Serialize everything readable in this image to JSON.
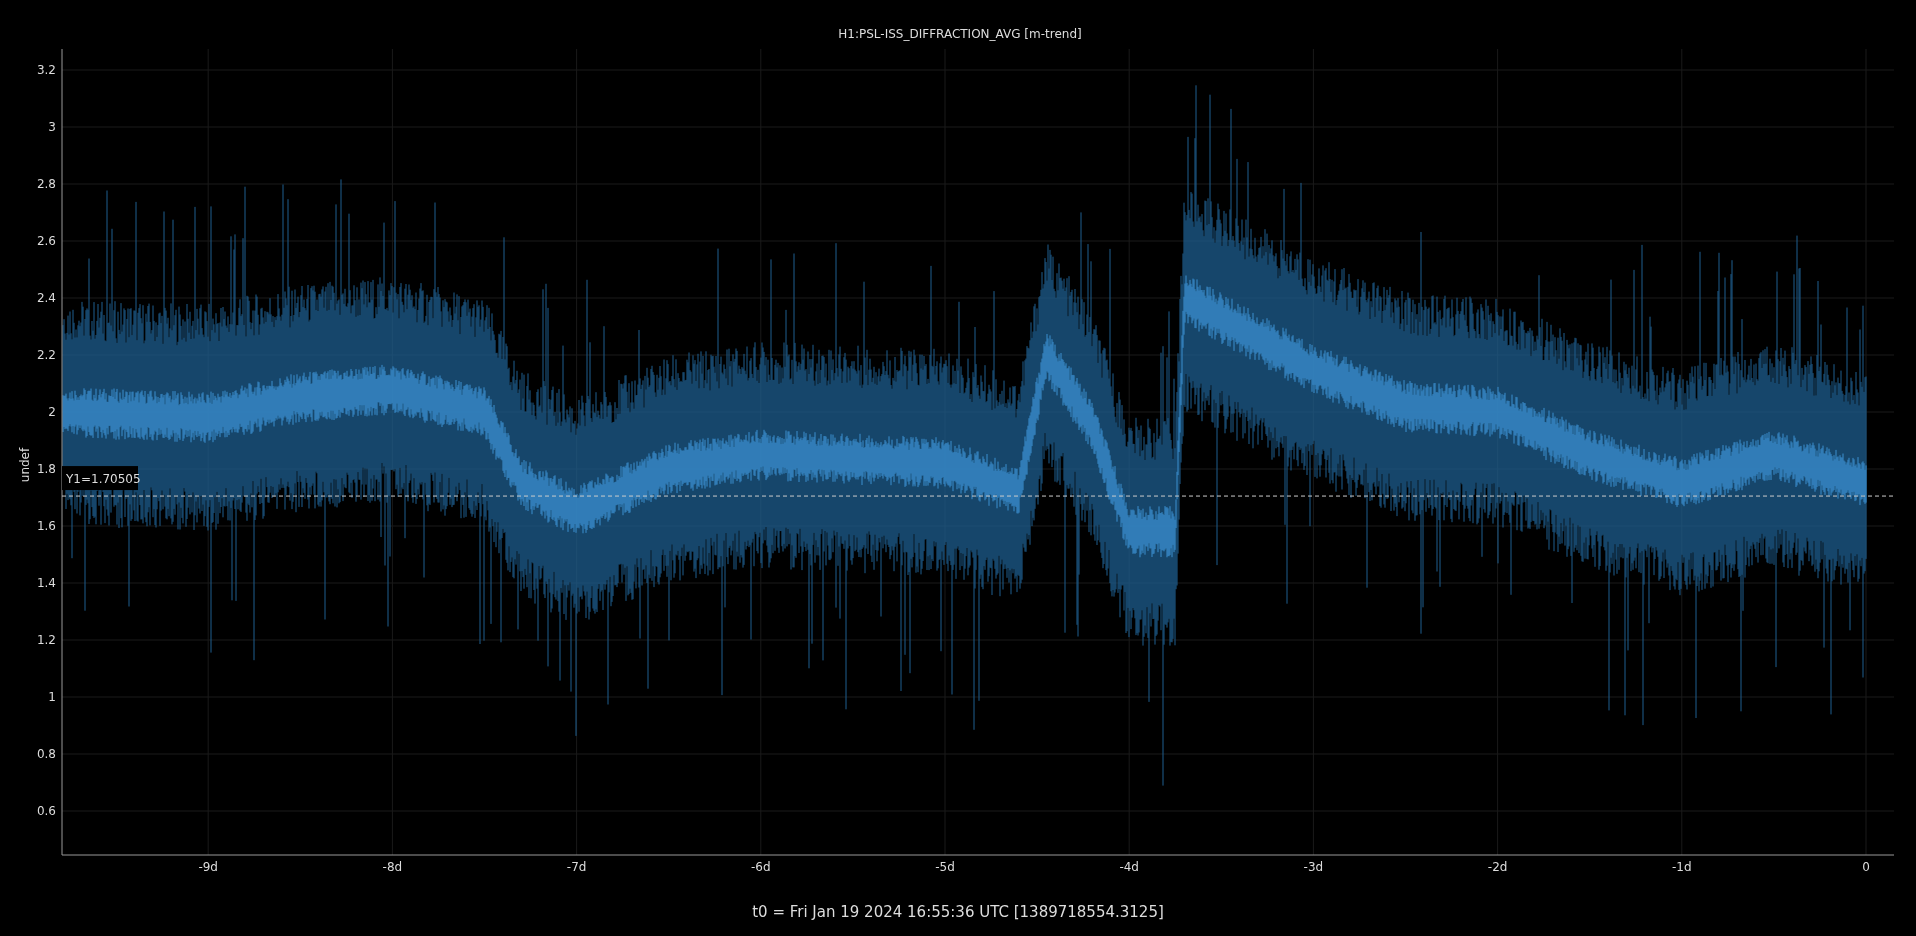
{
  "plot": {
    "title": "H1:PSL-ISS_DIFFRACTION_AVG [m-trend]",
    "y_axis_label": "undef",
    "y_ticks": [
      "3.2",
      "3",
      "2.8",
      "2.6",
      "2.4",
      "2.2",
      "2",
      "1.8",
      "1.6",
      "1.4",
      "1.2",
      "1",
      "0.8",
      "0.6"
    ],
    "x_ticks": [
      "-9d",
      "-8d",
      "-7d",
      "-6d",
      "-5d",
      "-4d",
      "-3d",
      "-2d",
      "-1d",
      "0"
    ],
    "cursor": {
      "label": "Y1=1.70505"
    }
  },
  "footer": "t0 = Fri Jan 19 2024 16:55:36 UTC [1389718554.3125]"
}
